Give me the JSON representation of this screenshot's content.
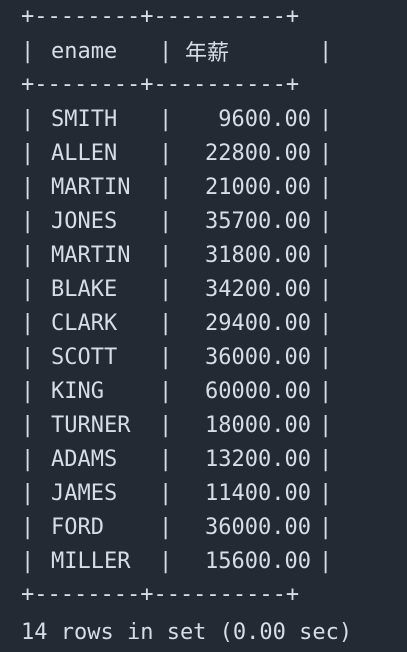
{
  "table": {
    "border_line": "+--------+----------+",
    "header": {
      "col1": "ename",
      "col2": "年薪"
    },
    "rows": [
      {
        "ename": "SMITH",
        "salary": "9600.00"
      },
      {
        "ename": "ALLEN",
        "salary": "22800.00"
      },
      {
        "ename": "MARTIN",
        "salary": "21000.00"
      },
      {
        "ename": "JONES",
        "salary": "35700.00"
      },
      {
        "ename": "MARTIN",
        "salary": "31800.00"
      },
      {
        "ename": "BLAKE",
        "salary": "34200.00"
      },
      {
        "ename": "CLARK",
        "salary": "29400.00"
      },
      {
        "ename": "SCOTT",
        "salary": "36000.00"
      },
      {
        "ename": "KING",
        "salary": "60000.00"
      },
      {
        "ename": "TURNER",
        "salary": "18000.00"
      },
      {
        "ename": "ADAMS",
        "salary": "13200.00"
      },
      {
        "ename": "JAMES",
        "salary": "11400.00"
      },
      {
        "ename": "FORD",
        "salary": "36000.00"
      },
      {
        "ename": "MILLER",
        "salary": "15600.00"
      }
    ]
  },
  "footer": {
    "status": "14 rows in set (0.00 sec)"
  },
  "colors": {
    "background": "#232a33",
    "text": "#d7dde6"
  }
}
